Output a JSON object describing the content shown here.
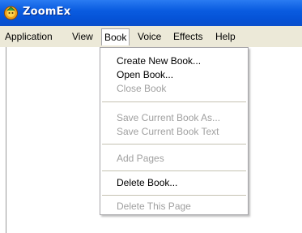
{
  "window": {
    "title": "ZoomEx",
    "icon": "zoomex-app-icon"
  },
  "menubar": {
    "items": [
      {
        "label": "Application"
      },
      {
        "label": "View"
      },
      {
        "label": "Book",
        "open": true
      },
      {
        "label": "Voice"
      },
      {
        "label": "Effects"
      },
      {
        "label": "Help"
      }
    ]
  },
  "book_menu": {
    "items": [
      {
        "label": "Create New Book...",
        "enabled": true
      },
      {
        "label": "Open Book...",
        "enabled": true
      },
      {
        "label": "Close Book",
        "enabled": false
      },
      {
        "label": "Save Current Book As...",
        "enabled": false
      },
      {
        "label": "Save Current Book Text",
        "enabled": false
      },
      {
        "label": "Add Pages",
        "enabled": false
      },
      {
        "label": "Delete Book...",
        "enabled": true
      },
      {
        "label": "Delete This Page",
        "enabled": false
      }
    ]
  },
  "colors": {
    "titlebar": "#0552d6",
    "menubar": "#ece9d8",
    "disabled_text": "#a0a0a0"
  }
}
